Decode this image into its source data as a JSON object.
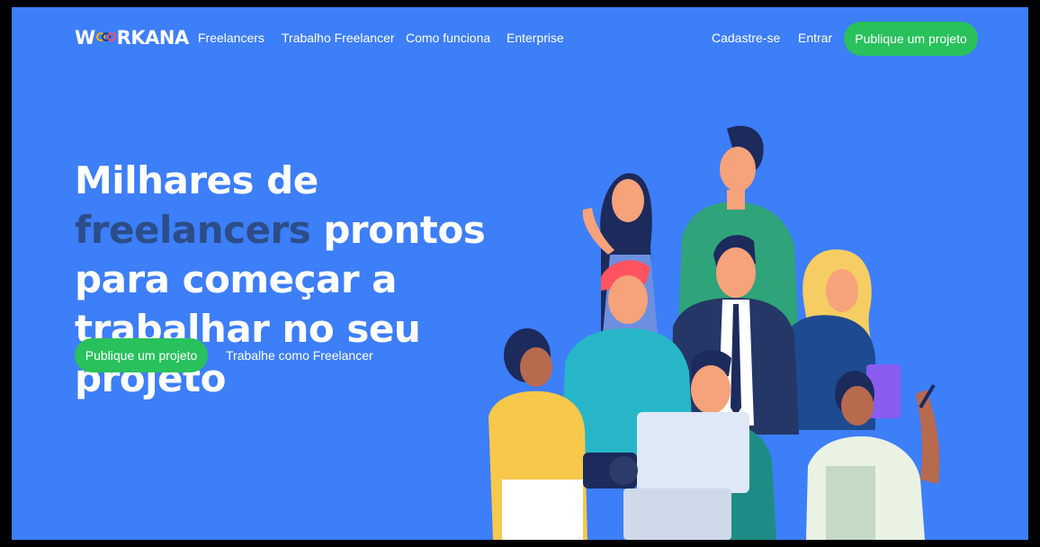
{
  "nav": {
    "logo_text": "WORKANA",
    "links": [
      "Freelancers",
      "Trabalho Freelancer",
      "Como funciona",
      "Enterprise"
    ],
    "signup": "Cadastre-se",
    "login": "Entrar",
    "publish_button": "Publique um projeto"
  },
  "hero": {
    "title_part1": "Milhares de ",
    "title_highlight": "freelancers",
    "title_part2": "prontos para começar a trabalhar no seu projeto",
    "cta_button": "Publique um projeto",
    "cta_link": "Trabalhe como Freelancer"
  },
  "colors": {
    "background": "#3d7ef9",
    "accent_green": "#28c15c",
    "highlight_text": "#2c4d87"
  },
  "icons": [
    "workana-logo",
    "freelancers-illustration"
  ]
}
